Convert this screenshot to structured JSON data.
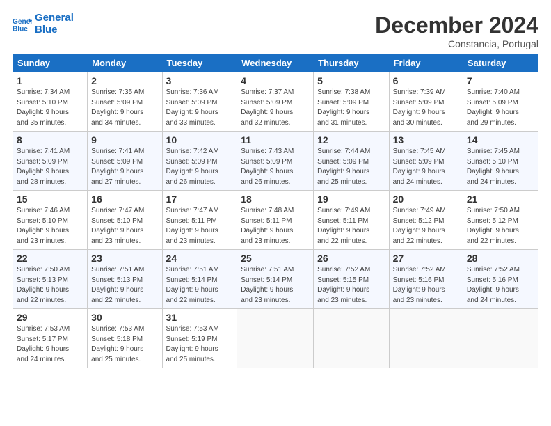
{
  "logo": {
    "line1": "General",
    "line2": "Blue"
  },
  "title": "December 2024",
  "location": "Constancia, Portugal",
  "days_header": [
    "Sunday",
    "Monday",
    "Tuesday",
    "Wednesday",
    "Thursday",
    "Friday",
    "Saturday"
  ],
  "weeks": [
    [
      {
        "day": "1",
        "detail": "Sunrise: 7:34 AM\nSunset: 5:10 PM\nDaylight: 9 hours\nand 35 minutes."
      },
      {
        "day": "2",
        "detail": "Sunrise: 7:35 AM\nSunset: 5:09 PM\nDaylight: 9 hours\nand 34 minutes."
      },
      {
        "day": "3",
        "detail": "Sunrise: 7:36 AM\nSunset: 5:09 PM\nDaylight: 9 hours\nand 33 minutes."
      },
      {
        "day": "4",
        "detail": "Sunrise: 7:37 AM\nSunset: 5:09 PM\nDaylight: 9 hours\nand 32 minutes."
      },
      {
        "day": "5",
        "detail": "Sunrise: 7:38 AM\nSunset: 5:09 PM\nDaylight: 9 hours\nand 31 minutes."
      },
      {
        "day": "6",
        "detail": "Sunrise: 7:39 AM\nSunset: 5:09 PM\nDaylight: 9 hours\nand 30 minutes."
      },
      {
        "day": "7",
        "detail": "Sunrise: 7:40 AM\nSunset: 5:09 PM\nDaylight: 9 hours\nand 29 minutes."
      }
    ],
    [
      {
        "day": "8",
        "detail": "Sunrise: 7:41 AM\nSunset: 5:09 PM\nDaylight: 9 hours\nand 28 minutes."
      },
      {
        "day": "9",
        "detail": "Sunrise: 7:41 AM\nSunset: 5:09 PM\nDaylight: 9 hours\nand 27 minutes."
      },
      {
        "day": "10",
        "detail": "Sunrise: 7:42 AM\nSunset: 5:09 PM\nDaylight: 9 hours\nand 26 minutes."
      },
      {
        "day": "11",
        "detail": "Sunrise: 7:43 AM\nSunset: 5:09 PM\nDaylight: 9 hours\nand 26 minutes."
      },
      {
        "day": "12",
        "detail": "Sunrise: 7:44 AM\nSunset: 5:09 PM\nDaylight: 9 hours\nand 25 minutes."
      },
      {
        "day": "13",
        "detail": "Sunrise: 7:45 AM\nSunset: 5:09 PM\nDaylight: 9 hours\nand 24 minutes."
      },
      {
        "day": "14",
        "detail": "Sunrise: 7:45 AM\nSunset: 5:10 PM\nDaylight: 9 hours\nand 24 minutes."
      }
    ],
    [
      {
        "day": "15",
        "detail": "Sunrise: 7:46 AM\nSunset: 5:10 PM\nDaylight: 9 hours\nand 23 minutes."
      },
      {
        "day": "16",
        "detail": "Sunrise: 7:47 AM\nSunset: 5:10 PM\nDaylight: 9 hours\nand 23 minutes."
      },
      {
        "day": "17",
        "detail": "Sunrise: 7:47 AM\nSunset: 5:11 PM\nDaylight: 9 hours\nand 23 minutes."
      },
      {
        "day": "18",
        "detail": "Sunrise: 7:48 AM\nSunset: 5:11 PM\nDaylight: 9 hours\nand 23 minutes."
      },
      {
        "day": "19",
        "detail": "Sunrise: 7:49 AM\nSunset: 5:11 PM\nDaylight: 9 hours\nand 22 minutes."
      },
      {
        "day": "20",
        "detail": "Sunrise: 7:49 AM\nSunset: 5:12 PM\nDaylight: 9 hours\nand 22 minutes."
      },
      {
        "day": "21",
        "detail": "Sunrise: 7:50 AM\nSunset: 5:12 PM\nDaylight: 9 hours\nand 22 minutes."
      }
    ],
    [
      {
        "day": "22",
        "detail": "Sunrise: 7:50 AM\nSunset: 5:13 PM\nDaylight: 9 hours\nand 22 minutes."
      },
      {
        "day": "23",
        "detail": "Sunrise: 7:51 AM\nSunset: 5:13 PM\nDaylight: 9 hours\nand 22 minutes."
      },
      {
        "day": "24",
        "detail": "Sunrise: 7:51 AM\nSunset: 5:14 PM\nDaylight: 9 hours\nand 22 minutes."
      },
      {
        "day": "25",
        "detail": "Sunrise: 7:51 AM\nSunset: 5:14 PM\nDaylight: 9 hours\nand 23 minutes."
      },
      {
        "day": "26",
        "detail": "Sunrise: 7:52 AM\nSunset: 5:15 PM\nDaylight: 9 hours\nand 23 minutes."
      },
      {
        "day": "27",
        "detail": "Sunrise: 7:52 AM\nSunset: 5:16 PM\nDaylight: 9 hours\nand 23 minutes."
      },
      {
        "day": "28",
        "detail": "Sunrise: 7:52 AM\nSunset: 5:16 PM\nDaylight: 9 hours\nand 24 minutes."
      }
    ],
    [
      {
        "day": "29",
        "detail": "Sunrise: 7:53 AM\nSunset: 5:17 PM\nDaylight: 9 hours\nand 24 minutes."
      },
      {
        "day": "30",
        "detail": "Sunrise: 7:53 AM\nSunset: 5:18 PM\nDaylight: 9 hours\nand 25 minutes."
      },
      {
        "day": "31",
        "detail": "Sunrise: 7:53 AM\nSunset: 5:19 PM\nDaylight: 9 hours\nand 25 minutes."
      },
      null,
      null,
      null,
      null
    ]
  ]
}
